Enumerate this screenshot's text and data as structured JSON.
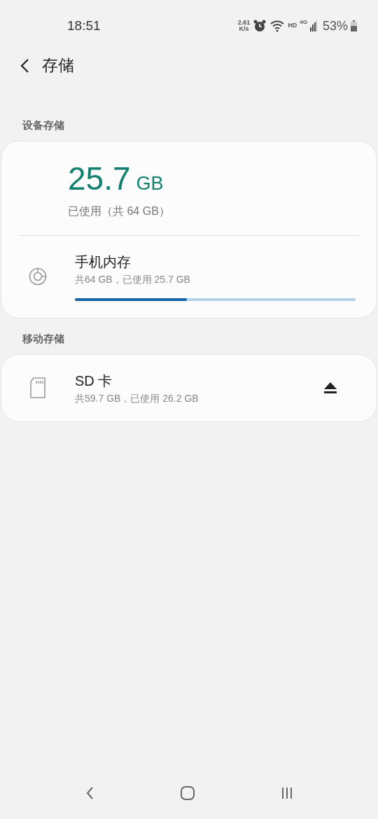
{
  "status_bar": {
    "time": "18:51",
    "speed_value": "2.61",
    "speed_unit": "K/s",
    "hd": "HD",
    "network": "4G",
    "battery": "53%"
  },
  "header": {
    "title": "存储"
  },
  "device_storage": {
    "label": "设备存储",
    "used_value": "25.7",
    "used_unit": "GB",
    "used_caption": "已使用（共 64 GB）",
    "items": [
      {
        "name": "手机内存",
        "detail": "共64 GB，已使用 25.7 GB",
        "level": 0.4
      }
    ]
  },
  "removable_storage": {
    "label": "移动存储",
    "items": [
      {
        "name": "SD 卡",
        "detail": "共59.7 GB，已使用 26.2 GB",
        "kind": "sd-card"
      }
    ]
  }
}
